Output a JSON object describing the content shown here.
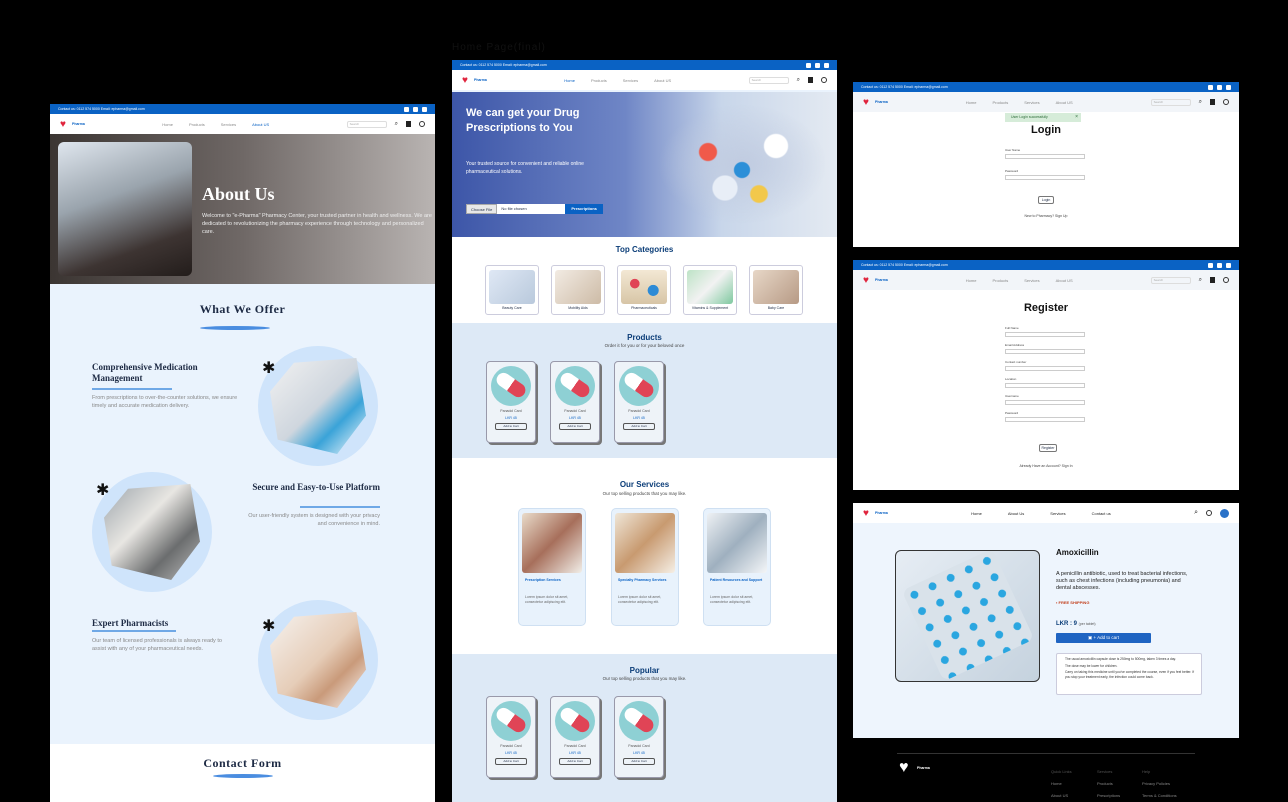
{
  "canvas_label": "Home Page(final)",
  "colors": {
    "brand": "#0a62c4",
    "accent_red": "#e0243d",
    "bg": "#eaf3fd"
  },
  "topbar": {
    "contact": "Contact us: 0112 574 5000   Email: epharma@gmail.com"
  },
  "logo": {
    "text": "Pharma"
  },
  "nav": {
    "home": "Home",
    "products": "Products",
    "services": "Services",
    "about": "About US",
    "about_us": "About Us",
    "contact": "Contact us",
    "search_placeholder": "Search"
  },
  "about_page": {
    "hero_title": "About Us",
    "hero_text": "Welcome to \"e-Pharma\" Pharmacy Center, your trusted partner in health and wellness. We are dedicated to revolutionizing the pharmacy experience through technology and personalized care.",
    "offer_title": "What We Offer",
    "offers": [
      {
        "title": "Comprehensive Medication Management",
        "desc": "From prescriptions to over-the-counter solutions, we ensure timely and accurate medication delivery."
      },
      {
        "title": "Secure and Easy-to-Use Platform",
        "desc": "Our user-friendly system is designed with your privacy and convenience in mind."
      },
      {
        "title": "Expert Pharmacists",
        "desc": "Our team of licensed professionals is always ready to assist with any of your pharmaceutical needs."
      }
    ],
    "contact_title": "Contact Form"
  },
  "home_page": {
    "hero_title": "We can get your Drug Prescriptions to You",
    "hero_text": "Your trusted source for convenient and reliable online pharmaceutical solutions.",
    "choose_file": "Choose File",
    "no_file": "No file chosen",
    "prescriptions_btn": "Prescriptions",
    "top_categories": "Top Categories",
    "categories": [
      "Beauty Care",
      "Mobility Aids",
      "Pharmaceuticals",
      "Vitamins & Supplement",
      "Baby Care"
    ],
    "products_title": "Products",
    "products_sub": "Order it for you or for your beloved once",
    "product_name": "Panadol Card",
    "product_price": "LKR 45",
    "add_to_cart": "Add to Cart",
    "services_title": "Our Services",
    "services_sub": "Our top selling products that you may like.",
    "services": [
      {
        "title": "Prescription Services",
        "desc": "Lorem ipsum dolor sit amet, consectetur adipiscing elit."
      },
      {
        "title": "Specialty Pharmacy Services",
        "desc": "Lorem ipsum dolor sit amet, consectetur adipiscing elit."
      },
      {
        "title": "Patient Resources and Support",
        "desc": "Lorem ipsum dolor sit amet, consectetur adipiscing elit."
      }
    ],
    "popular_title": "Popular",
    "popular_sub": "Our top selling products that you may like."
  },
  "login_page": {
    "toast": "User Login successfully",
    "title": "Login",
    "user_name": "User Name",
    "password": "Password",
    "button": "Login",
    "footer_link": "New to Pharmacy? Sign Up"
  },
  "register_page": {
    "title": "Register",
    "fields": [
      "Full Name",
      "Email Address",
      "Contact number",
      "Location",
      "Username",
      "Password"
    ],
    "button": "Register",
    "footer_link": "Already Have an Account? Sign In"
  },
  "product_page": {
    "name": "Amoxicillin",
    "desc": "A penicillin antibiotic, used to treat bacterial infections, such as chest infections (including pneumonia) and dental abscesses.",
    "shipping": "FREE SHIPPING",
    "price": "LKR : 9",
    "price_unit": "(per tablet)",
    "add_btn": "+ Add to cart",
    "notes": [
      "The usual amoxicillin capsule dose is 250mg to 500mg, taken 3 times a day.",
      "The dose may be lower for children.",
      "Carry on taking this medicine until you've completed the course, even if you feel better. If you stop your treatment early, the infection could come back."
    ]
  },
  "footer": {
    "cols": [
      [
        "Quick Links",
        "Home",
        "About US"
      ],
      [
        "Services",
        "Products",
        "Prescriptions"
      ],
      [
        "Help",
        "Privacy Policies",
        "Terms & Conditions"
      ]
    ]
  }
}
